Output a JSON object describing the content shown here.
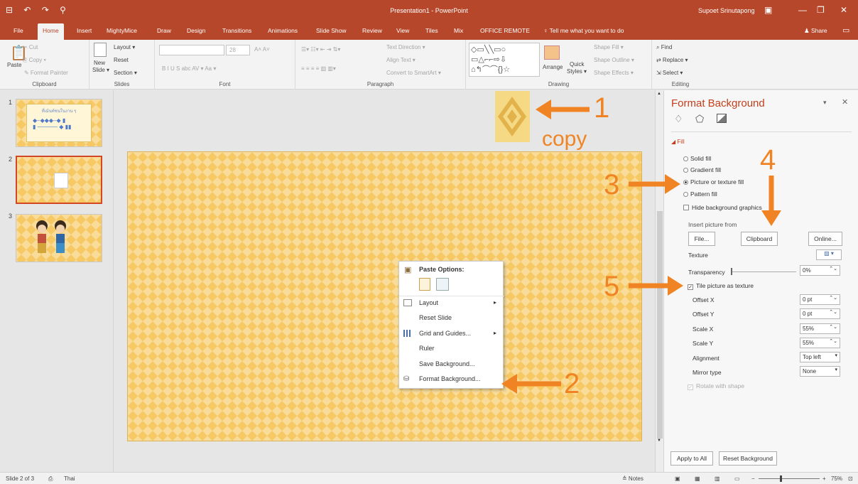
{
  "titlebar": {
    "title": "Presentation1 - PowerPoint",
    "user": "Supoet Srinutapong",
    "qat": "⊟ ↶ ↷ ⚲",
    "minimize": "—",
    "restore": "❐",
    "close": "✕",
    "acct_icon": "▣"
  },
  "tabs": [
    "File",
    "Home",
    "Insert",
    "MightyMice",
    "Draw",
    "Design",
    "Transitions",
    "Animations",
    "Slide Show",
    "Review",
    "View",
    "Tiles",
    "Mix",
    "OFFICE REMOTE"
  ],
  "tellme": "♀ Tell me what you want to do",
  "share": "♟ Share",
  "ribbon": {
    "clipboard": {
      "paste": "Paste",
      "cut": "✂ Cut",
      "copy": "⎘ Copy ▾",
      "painter": "✎ Format Painter",
      "label": "Clipboard"
    },
    "slides": {
      "new_slide": "New",
      "new_slide2": "Slide ▾",
      "layout": "Layout ▾",
      "reset": "Reset",
      "section": "Section ▾",
      "label": "Slides"
    },
    "font": {
      "size": "28",
      "label": "Font",
      "row2": "B  I  U  S  abc  AV ▾  Aa ▾",
      "grow": "A˄ A˅"
    },
    "paragraph": {
      "text_direction": "Text Direction ▾",
      "align_text": "Align Text ▾",
      "smartart": "Convert to SmartArt ▾",
      "label": "Paragraph"
    },
    "drawing": {
      "arrange": "Arrange",
      "quick": "Quick",
      "styles": "Styles ▾",
      "fill": "Shape Fill ▾",
      "outline": "Shape Outline ▾",
      "effects": "Shape Effects ▾",
      "label": "Drawing"
    },
    "editing": {
      "find": "⌕ Find",
      "replace": "⇄ Replace ▾",
      "select": "⇲ Select ▾",
      "label": "Editing"
    }
  },
  "slides_panel": [
    {
      "num": "1",
      "caption": "ที่เม้นท์ชนในงาน ๆ"
    },
    {
      "num": "2"
    },
    {
      "num": "3"
    }
  ],
  "annotations": {
    "n1": "1",
    "n2": "2",
    "n3": "3",
    "n4": "4",
    "n5": "5",
    "copy": "copy"
  },
  "context_menu": {
    "header": "Paste Options:",
    "items": [
      {
        "label": "Layout",
        "arrow": "▸"
      },
      {
        "label": "Reset Slide"
      },
      {
        "label": "Grid and Guides...",
        "arrow": "▸"
      },
      {
        "label": "Ruler"
      },
      {
        "label": "Save Background..."
      },
      {
        "label": "Format Background..."
      }
    ]
  },
  "pane": {
    "title": "Format Background",
    "section": "Fill",
    "options": [
      "Solid fill",
      "Gradient fill",
      "Picture or texture fill",
      "Pattern fill"
    ],
    "selected_option": "Picture or texture fill",
    "hide_bg": "Hide background graphics",
    "insert_from": "Insert picture from",
    "btn_file": "File...",
    "btn_clipboard": "Clipboard",
    "btn_online": "Online...",
    "texture": "Texture",
    "transparency": "Transparency",
    "transparency_val": "0%",
    "tile": "Tile picture as texture",
    "tile_checked": true,
    "offset_x": "Offset X",
    "offset_x_val": "0 pt",
    "offset_y": "Offset Y",
    "offset_y_val": "0 pt",
    "scale_x": "Scale X",
    "scale_x_val": "55%",
    "scale_y": "Scale Y",
    "scale_y_val": "55%",
    "alignment": "Alignment",
    "alignment_val": "Top left",
    "mirror": "Mirror type",
    "mirror_val": "None",
    "rotate": "Rotate with shape",
    "apply_all": "Apply to All",
    "reset_bg": "Reset Background"
  },
  "status": {
    "slide": "Slide 2 of 3",
    "lang": "Thai",
    "notes": "≙ Notes",
    "zoom": "75%",
    "plus": "+",
    "minus": "−"
  }
}
